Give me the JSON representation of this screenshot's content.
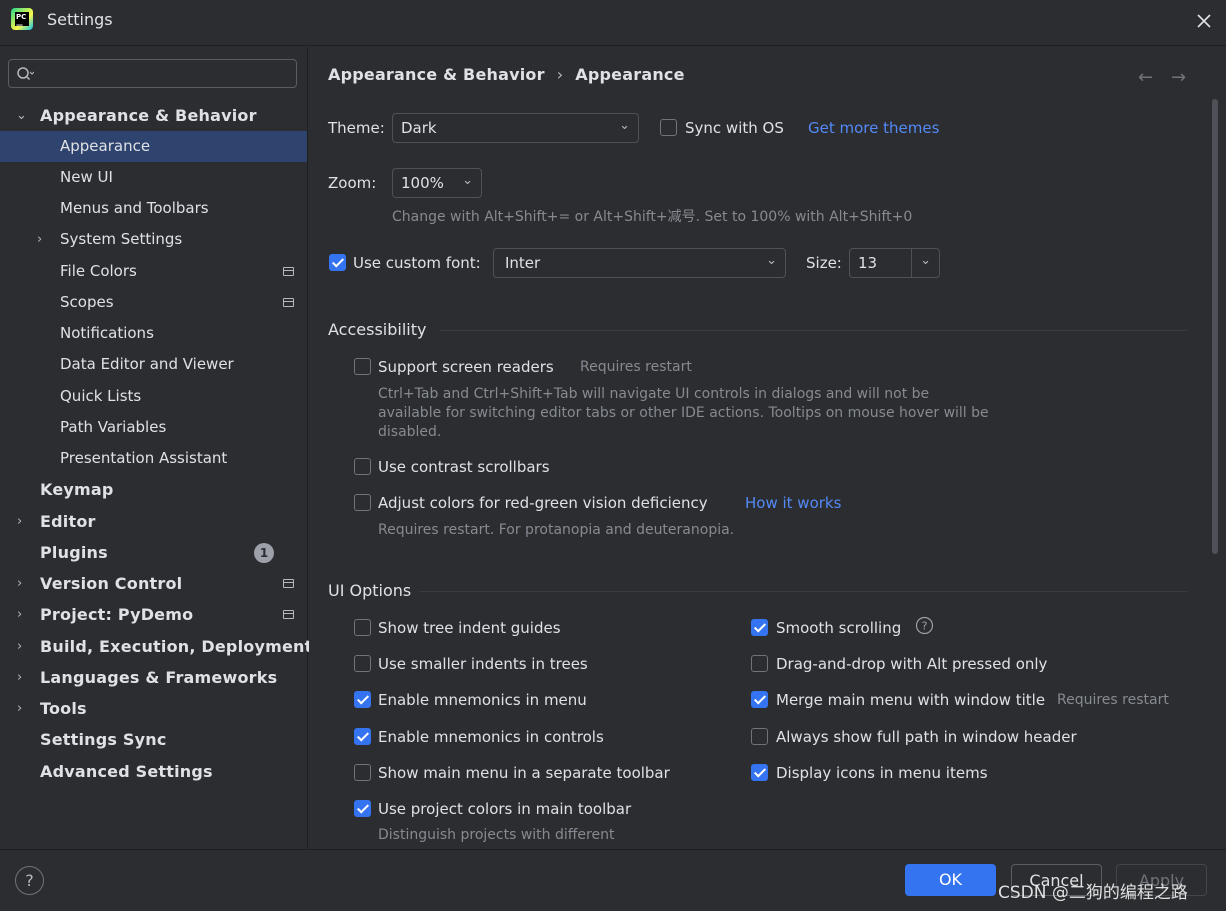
{
  "window": {
    "title": "Settings"
  },
  "search": {
    "placeholder": "",
    "value": ""
  },
  "sidebar": {
    "items": [
      {
        "label": "Appearance & Behavior",
        "level": 0,
        "expanded": true
      },
      {
        "label": "Appearance",
        "level": 1,
        "selected": true
      },
      {
        "label": "New UI",
        "level": 1
      },
      {
        "label": "Menus and Toolbars",
        "level": 1
      },
      {
        "label": "System Settings",
        "level": 1,
        "collapsed": true
      },
      {
        "label": "File Colors",
        "level": 1,
        "project_icon": true
      },
      {
        "label": "Scopes",
        "level": 1,
        "project_icon": true
      },
      {
        "label": "Notifications",
        "level": 1
      },
      {
        "label": "Data Editor and Viewer",
        "level": 1
      },
      {
        "label": "Quick Lists",
        "level": 1
      },
      {
        "label": "Path Variables",
        "level": 1
      },
      {
        "label": "Presentation Assistant",
        "level": 1
      },
      {
        "label": "Keymap",
        "level": 0
      },
      {
        "label": "Editor",
        "level": 0,
        "collapsed": true
      },
      {
        "label": "Plugins",
        "level": 0,
        "badge": "1"
      },
      {
        "label": "Version Control",
        "level": 0,
        "collapsed": true,
        "project_icon": true
      },
      {
        "label": "Project: PyDemo",
        "level": 0,
        "collapsed": true,
        "project_icon": true
      },
      {
        "label": "Build, Execution, Deployment",
        "level": 0,
        "collapsed": true
      },
      {
        "label": "Languages & Frameworks",
        "level": 0,
        "collapsed": true
      },
      {
        "label": "Tools",
        "level": 0,
        "collapsed": true
      },
      {
        "label": "Settings Sync",
        "level": 0
      },
      {
        "label": "Advanced Settings",
        "level": 0
      }
    ]
  },
  "breadcrumb": {
    "parent": "Appearance & Behavior",
    "separator": "›",
    "current": "Appearance"
  },
  "nav": {
    "back": "←",
    "forward": "→"
  },
  "theme": {
    "label": "Theme:",
    "value": "Dark",
    "sync_label": "Sync with OS",
    "sync_checked": false,
    "more_link": "Get more themes"
  },
  "zoom": {
    "label": "Zoom:",
    "value": "100%",
    "hint": "Change with Alt+Shift+= or Alt+Shift+减号. Set to 100% with Alt+Shift+0"
  },
  "font": {
    "custom_label": "Use custom font:",
    "custom_checked": true,
    "value": "Inter",
    "size_label": "Size:",
    "size_value": "13"
  },
  "accessibility": {
    "title": "Accessibility",
    "screen_readers": {
      "label": "Support screen readers",
      "checked": false,
      "note": "Requires restart",
      "desc": "Ctrl+Tab and Ctrl+Shift+Tab will navigate UI controls in dialogs and will not be available for switching editor tabs or other IDE actions. Tooltips on mouse hover will be disabled."
    },
    "contrast": {
      "label": "Use contrast scrollbars",
      "checked": false
    },
    "color_vision": {
      "label": "Adjust colors for red-green vision deficiency",
      "checked": false,
      "link": "How it works",
      "desc": "Requires restart. For protanopia and deuteranopia."
    }
  },
  "ui_options": {
    "title": "UI Options",
    "left": [
      {
        "label": "Show tree indent guides",
        "checked": false
      },
      {
        "label": "Use smaller indents in trees",
        "checked": false
      },
      {
        "label": "Enable mnemonics in menu",
        "checked": true
      },
      {
        "label": "Enable mnemonics in controls",
        "checked": true
      },
      {
        "label": "Show main menu in a separate toolbar",
        "checked": false
      },
      {
        "label": "Use project colors in main toolbar",
        "checked": true
      }
    ],
    "project_colors_desc": "Distinguish projects with different",
    "right": [
      {
        "label": "Smooth scrolling",
        "checked": true
      },
      {
        "label": "Drag-and-drop with Alt pressed only",
        "checked": false
      },
      {
        "label": "Merge main menu with window title",
        "checked": true,
        "note": "Requires restart"
      },
      {
        "label": "Always show full path in window header",
        "checked": false
      },
      {
        "label": "Display icons in menu items",
        "checked": true
      }
    ]
  },
  "buttons": {
    "help": "?",
    "ok": "OK",
    "cancel": "Cancel",
    "apply": "Apply"
  },
  "watermark": "CSDN @二狗的编程之路",
  "colors": {
    "accent": "#3574f0",
    "link": "#548af7",
    "background": "#2b2d30",
    "selection": "#2e436e"
  }
}
